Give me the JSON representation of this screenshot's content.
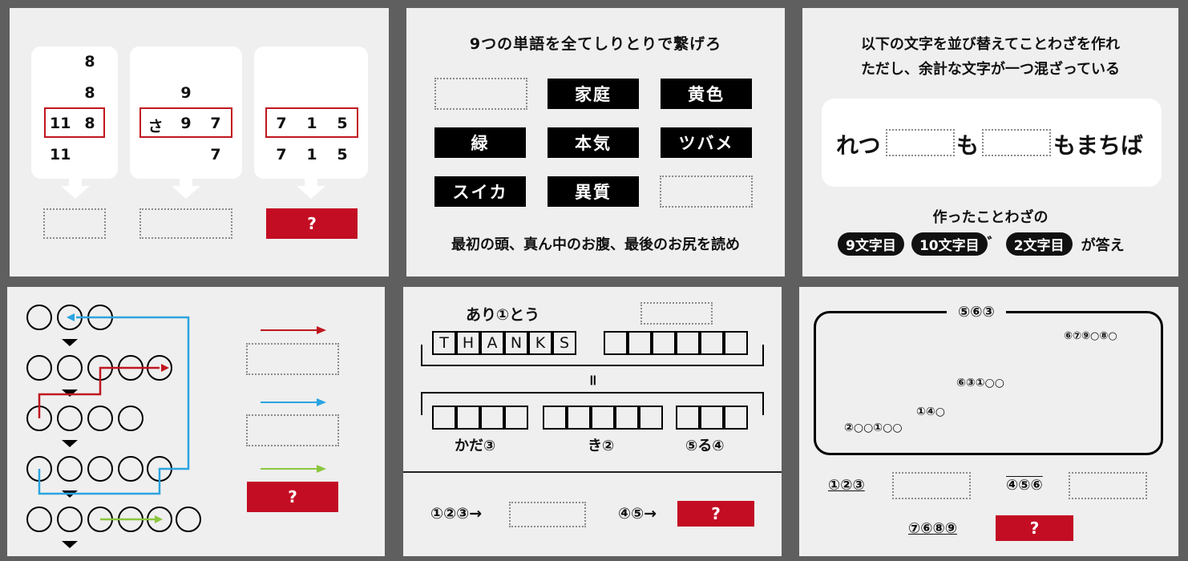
{
  "panel1": {
    "col1": {
      "rows": [
        "8",
        "8",
        "11",
        "8",
        "11"
      ]
    },
    "col2": {
      "top": "9",
      "row_a": "さ",
      "row_b": "9",
      "row_c": "7",
      "bottom": "7"
    },
    "col3": {
      "r1": [
        "7",
        "1",
        "5"
      ],
      "r2": [
        "7",
        "1",
        "5"
      ]
    },
    "answer": "?"
  },
  "panel2": {
    "title": "9つの単語を全てしりとりで繋げろ",
    "words": [
      "家庭",
      "黄色",
      "緑",
      "本気",
      "ツバメ",
      "スイカ",
      "異質"
    ],
    "hint": "最初の頭、真ん中のお腹、最後のお尻を読め"
  },
  "panel3": {
    "line1": "以下の文字を並び替えてことわざを作れ",
    "line2": "ただし、余計な文字が一つ混ざっている",
    "puzzle_a": "れつ",
    "puzzle_b": "も",
    "puzzle_c": "もまちば",
    "made": "作ったことわざの",
    "pill1": "9文字目",
    "pill2": "10文字目",
    "dakuten": "゛",
    "pill3": "2文字目",
    "tail": "が答え"
  },
  "panel4": {
    "answer": "?",
    "colors": {
      "red": "#c0161f",
      "blue": "#2aa4e0",
      "green": "#8cc63f"
    }
  },
  "panel5": {
    "top_word": "あり①とう",
    "letters": [
      "T",
      "H",
      "A",
      "N",
      "K",
      "S"
    ],
    "equals": "॥",
    "label1": "かだ③",
    "label2": "き②",
    "label3": "⑤る④",
    "q1": "①②③→",
    "q2": "④⑤→",
    "answer": "?"
  },
  "panel6": {
    "title": "⑤⑥③",
    "l1": "⑥⑦⑨○⑧○",
    "l2": "⑥③①○○",
    "l3": "①④○",
    "l4": "②○○①○○",
    "c1": "①②③",
    "c2": "④⑤⑥",
    "c3": "⑦⑥⑧⑨",
    "answer": "?"
  }
}
